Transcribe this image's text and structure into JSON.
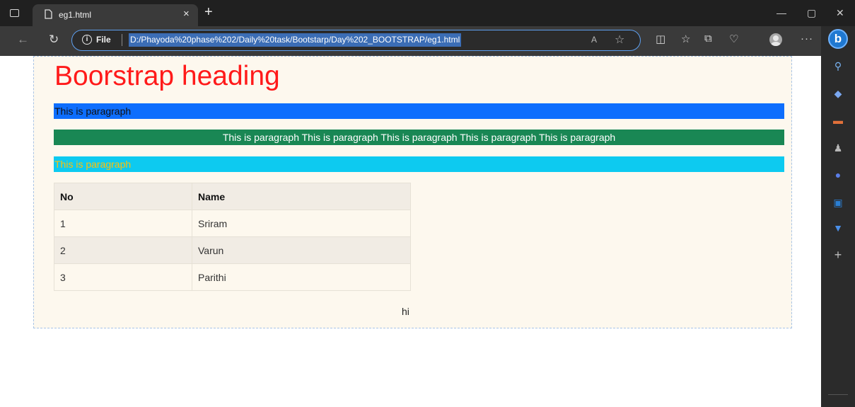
{
  "browser": {
    "tab": {
      "title": "eg1.html",
      "close_glyph": "×"
    },
    "new_tab_glyph": "+",
    "window_controls": {
      "minimize": "—",
      "restore": "▢",
      "close": "✕"
    },
    "address": {
      "scheme_label": "File",
      "url": "D:/Phayoda%20phase%202/Daily%20task/Bootstarp/Day%202_BOOTSTRAP/eg1.html",
      "read_aloud": "A",
      "favorite_glyph": "☆"
    },
    "toolbar_icons": [
      "split-screen-icon",
      "favorites-icon",
      "collections-icon",
      "health-icon",
      "profile-icon",
      "more-icon"
    ],
    "more_glyph": "···",
    "sidebar": {
      "bing_label": "b",
      "icons": [
        "search-icon",
        "shopping-icon",
        "tools-icon",
        "games-icon",
        "microsoft-365-icon",
        "outlook-icon",
        "drop-icon",
        "add-icon"
      ],
      "add_glyph": "+"
    }
  },
  "page": {
    "heading": "Boorstrap heading",
    "paragraph_blue": "This is paragraph",
    "paragraph_green": "This is paragraph This is paragraph This is paragraph This is paragraph This is paragraph",
    "paragraph_cyan": "This is paragraph",
    "table": {
      "headers": [
        "No",
        "Name"
      ],
      "rows": [
        [
          "1",
          "Sriram"
        ],
        [
          "2",
          "Varun"
        ],
        [
          "3",
          "Parithi"
        ]
      ]
    },
    "footer_text": "hi"
  },
  "colors": {
    "heading": "#ff1a1a",
    "blue_bar": "#0d6efd",
    "green_bar": "#198754",
    "cyan_bar": "#0dcaf0",
    "cyan_text": "#ffc107",
    "container_bg": "#fdf8ee"
  }
}
